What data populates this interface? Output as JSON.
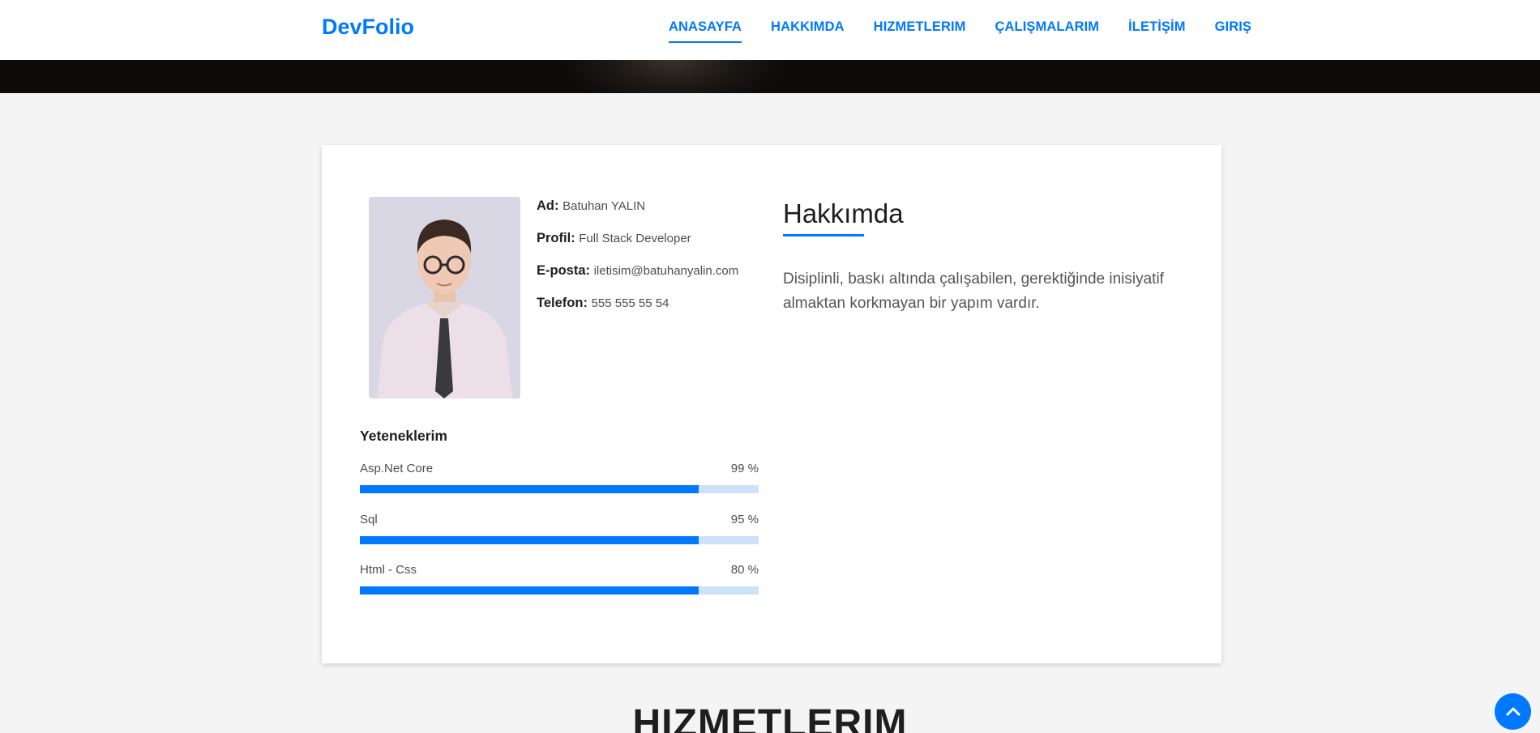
{
  "nav": {
    "brand": "DevFolio",
    "items": [
      {
        "label": "ANASAYFA",
        "active": true
      },
      {
        "label": "HAKKIMDA",
        "active": false
      },
      {
        "label": "HIZMETLERIM",
        "active": false
      },
      {
        "label": "ÇALIŞMALARIM",
        "active": false
      },
      {
        "label": "İLETİŞİM",
        "active": false
      },
      {
        "label": "GIRIŞ",
        "active": false
      }
    ]
  },
  "profile": {
    "photo_icon": "profile-photo",
    "fields": [
      {
        "label": "Ad:",
        "value": "Batuhan YALIN"
      },
      {
        "label": "Profil:",
        "value": "Full Stack Developer"
      },
      {
        "label": "E-posta:",
        "value": "iletisim@batuhanyalin.com"
      },
      {
        "label": "Telefon:",
        "value": "555 555 55 54"
      }
    ]
  },
  "skills": {
    "title": "Yeteneklerim",
    "items": [
      {
        "name": "Asp.Net Core",
        "percent_label": "99 %",
        "fill": 0.85
      },
      {
        "name": "Sql",
        "percent_label": "95 %",
        "fill": 0.85
      },
      {
        "name": "Html - Css",
        "percent_label": "80 %",
        "fill": 0.85
      }
    ]
  },
  "about": {
    "title": "Hakkımda",
    "text": "Disiplinli, baskı altında çalışabilen, gerektiğinde inisiyatif almaktan korkmayan bir yapım vardır."
  },
  "next_section": {
    "title": "HIZMETLERIM"
  },
  "scroll_top": {
    "icon": "chevron-up-icon"
  },
  "colors": {
    "accent": "#0078ff",
    "bar_track": "#cde1f8",
    "page_bg": "#f4f4f4"
  }
}
